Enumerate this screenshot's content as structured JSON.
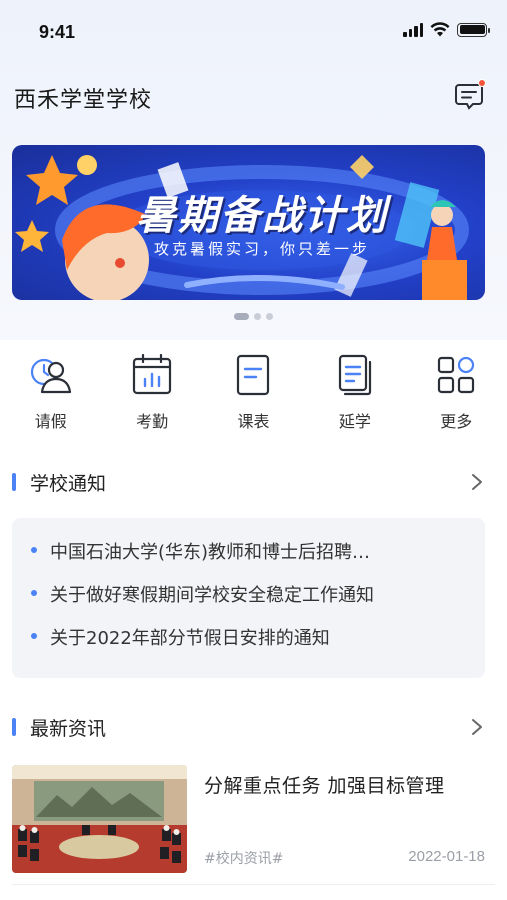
{
  "status_bar": {
    "time": "9:41"
  },
  "header": {
    "school_name": "西禾学堂学校",
    "message_icon": "message-icon"
  },
  "banner": {
    "title": "暑期备战计划",
    "subtitle": "攻克暑假实习，你只差一步",
    "slide_count": 3,
    "active_slide": 1
  },
  "quick_actions": [
    {
      "label": "请假",
      "icon": "leave-request-icon"
    },
    {
      "label": "考勤",
      "icon": "attendance-icon"
    },
    {
      "label": "课表",
      "icon": "timetable-icon"
    },
    {
      "label": "延学",
      "icon": "extended-study-icon"
    },
    {
      "label": "更多",
      "icon": "more-apps-icon"
    }
  ],
  "notices": {
    "section_title": "学校通知",
    "items": [
      "中国石油大学(华东)教师和博士后招聘…",
      "关于做好寒假期间学校安全稳定工作通知",
      "关于2022年部分节假日安排的通知"
    ]
  },
  "news": {
    "section_title": "最新资讯",
    "items": [
      {
        "title": "分解重点任务  加强目标管理",
        "tag": "#校内资讯#",
        "date": "2022-01-18"
      }
    ]
  },
  "colors": {
    "accent": "#4b82f6",
    "banner_blue": "#2240c8",
    "notice_bg": "#f3f4f7"
  }
}
